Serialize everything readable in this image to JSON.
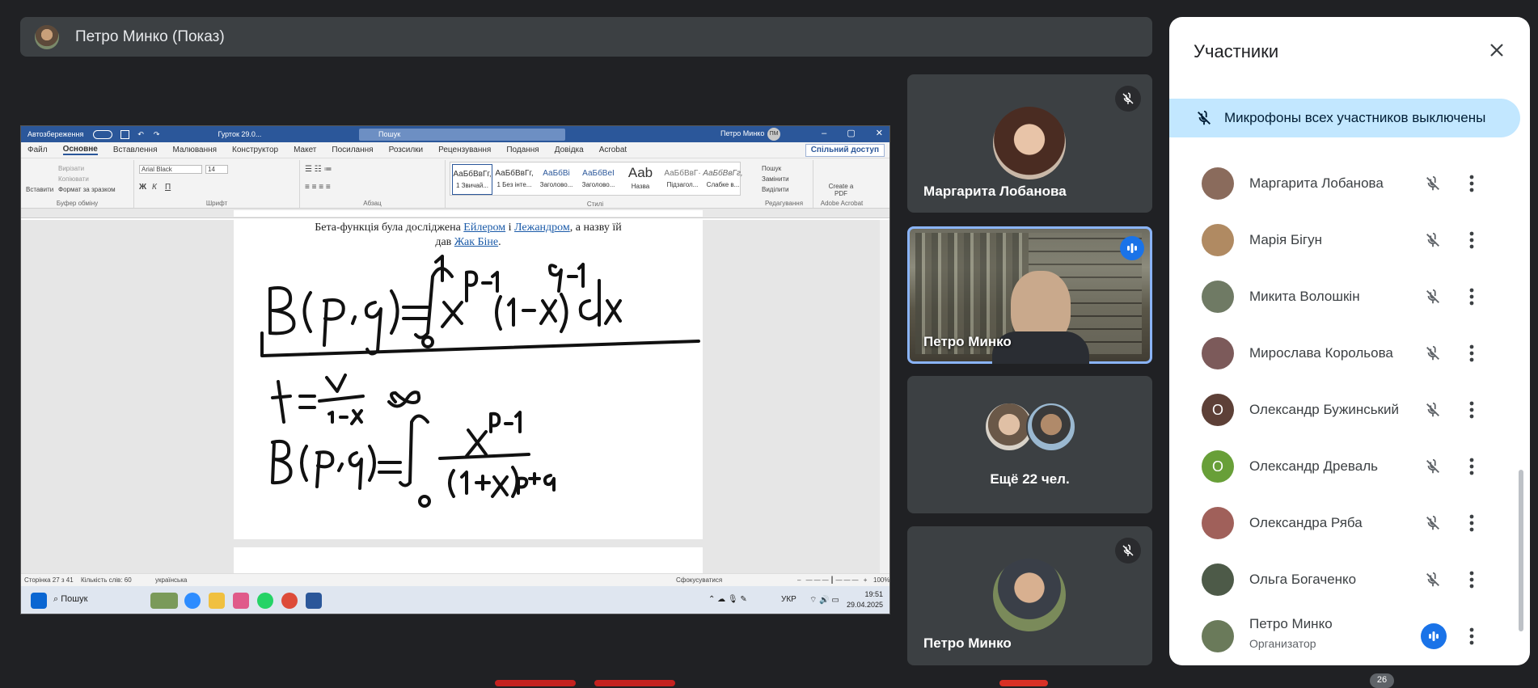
{
  "presenter": {
    "name": "Петро Минко (Показ)"
  },
  "word": {
    "autosave": "Автозбереження",
    "doc_title": "Гурток 29.0...",
    "search": "Пошук",
    "user": "Петро Минко",
    "user_initials": "ПМ",
    "tabs": [
      "Файл",
      "Основне",
      "Вставлення",
      "Малювання",
      "Конструктор",
      "Макет",
      "Посилання",
      "Розсилки",
      "Рецензування",
      "Подання",
      "Довідка",
      "Acrobat"
    ],
    "share": "Спільний доступ",
    "paste": "Вставити",
    "cut": "Вирізати",
    "copy": "Копіювати",
    "format_painter": "Формат за зразком",
    "clipboard_group": "Буфер обміну",
    "font_name": "Arial Black",
    "font_size": "14",
    "font_group": "Шрифт",
    "paragraph_group": "Абзац",
    "styles": [
      {
        "sample": "АаБбВвГг,",
        "name": "1 Звичай..."
      },
      {
        "sample": "АаБбВвГг,",
        "name": "1 Без інте..."
      },
      {
        "sample": "АаБбВі",
        "name": "Заголово..."
      },
      {
        "sample": "АаБбВеІ",
        "name": "Заголово..."
      },
      {
        "sample": "Aab",
        "name": "Назва"
      },
      {
        "sample": "АаБбВвГ·",
        "name": "Підзагол..."
      },
      {
        "sample": "АаБбВвГг,",
        "name": "Слабке в..."
      }
    ],
    "styles_group": "Стилі",
    "find": "Пошук",
    "replace": "Замінити",
    "select": "Виділити",
    "editing_group": "Редагування",
    "create_pdf": "Create a PDF",
    "acrobat_group": "Adobe Acrobat",
    "doc_line1_pre": "Бета-функція була досліджена ",
    "doc_link_euler": "Ейлером",
    "doc_line1_mid": " і ",
    "doc_link_legendre": "Лежандром",
    "doc_line1_post": ", а назву їй",
    "doc_line2_pre": "дав ",
    "doc_link_binet": "Жак Біне",
    "doc_line2_post": ".",
    "status_page": "Сторінка 27 з 41",
    "status_words": "Кількість слів: 60",
    "status_lang": "українська",
    "status_focus": "Сфокусуватися",
    "status_zoom": "100%"
  },
  "taskbar": {
    "search": "Пошук",
    "lang": "УКР",
    "time": "19:51",
    "date": "29.04.2025"
  },
  "tiles": [
    {
      "name": "Маргарита Лобанова",
      "muted": true
    },
    {
      "name": "Петро Минко",
      "speaking": true
    },
    {
      "name": "Ещё 22 чел."
    },
    {
      "name": "Петро Минко",
      "muted": true
    }
  ],
  "panel": {
    "title": "Участники",
    "banner": "Микрофоны всех участников выключены",
    "participants": [
      {
        "name": "Маргарита Лобанова",
        "avatar_color": "#8a6b5c",
        "muted": true
      },
      {
        "name": "Марія Бігун",
        "avatar_color": "#b08a62",
        "muted": true
      },
      {
        "name": "Микита Волошкін",
        "avatar_color": "#6f7a64",
        "muted": true
      },
      {
        "name": "Мирослава Корольова",
        "avatar_color": "#7c5a5a",
        "muted": true
      },
      {
        "name": "Олександр Бужинський",
        "initial": "О",
        "avatar_color": "#5d4037",
        "muted": true
      },
      {
        "name": "Олександр Древаль",
        "initial": "О",
        "avatar_color": "#689f38",
        "muted": true
      },
      {
        "name": "Олександра Ряба",
        "avatar_color": "#a0605a",
        "muted": true
      },
      {
        "name": "Ольга Богаченко",
        "avatar_color": "#4d5a48",
        "muted": true
      },
      {
        "name": "Петро Минко",
        "role": "Организатор",
        "avatar_color": "#6a7a5a",
        "speaking": true
      }
    ]
  },
  "bottom": {
    "count": "26"
  },
  "colors": {
    "accent": "#1a73e8",
    "banner": "#c2e7ff",
    "tile_bg": "#3c4043",
    "page_bg": "#202124"
  }
}
